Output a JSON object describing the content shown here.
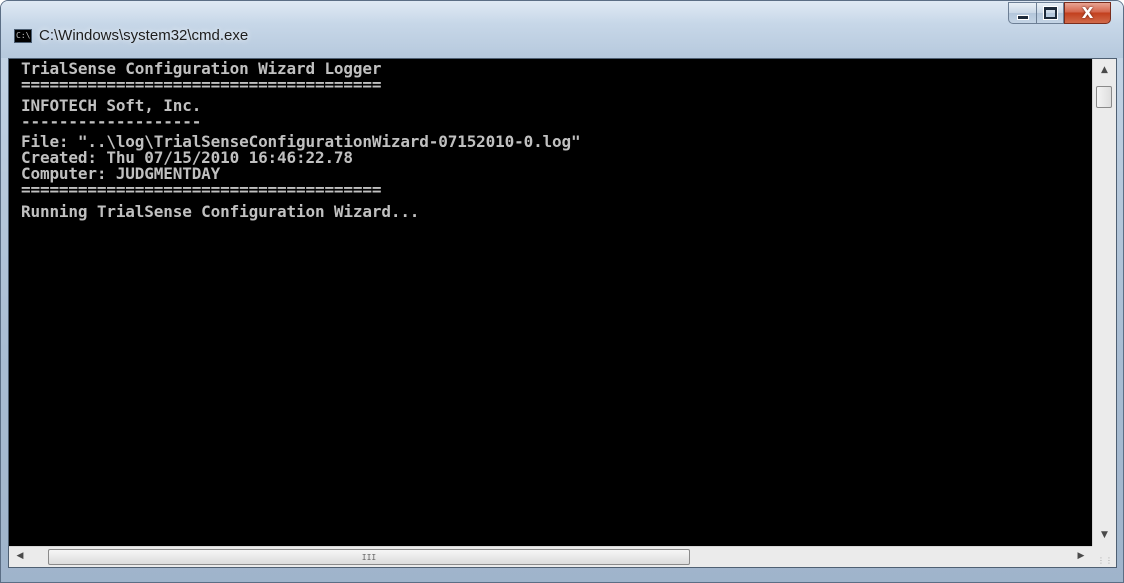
{
  "window": {
    "title": "C:\\Windows\\system32\\cmd.exe",
    "icon_label": "C:\\"
  },
  "caption_buttons": {
    "close_label": "X"
  },
  "console": {
    "lines": [
      "TrialSense Configuration Wizard Logger",
      "======================================",
      "INFOTECH Soft, Inc.",
      "-------------------",
      "File: \"..\\log\\TrialSenseConfigurationWizard-07152010-0.log\"",
      "Created: Thu 07/15/2010 16:46:22.78",
      "Computer: JUDGMENTDAY",
      "======================================",
      "Running TrialSense Configuration Wizard..."
    ]
  },
  "scrollbar": {
    "up_icon": "scroll-up-arrow",
    "down_icon": "scroll-down-arrow",
    "left_icon": "scroll-left-arrow",
    "right_icon": "scroll-right-arrow",
    "grip": "III"
  }
}
